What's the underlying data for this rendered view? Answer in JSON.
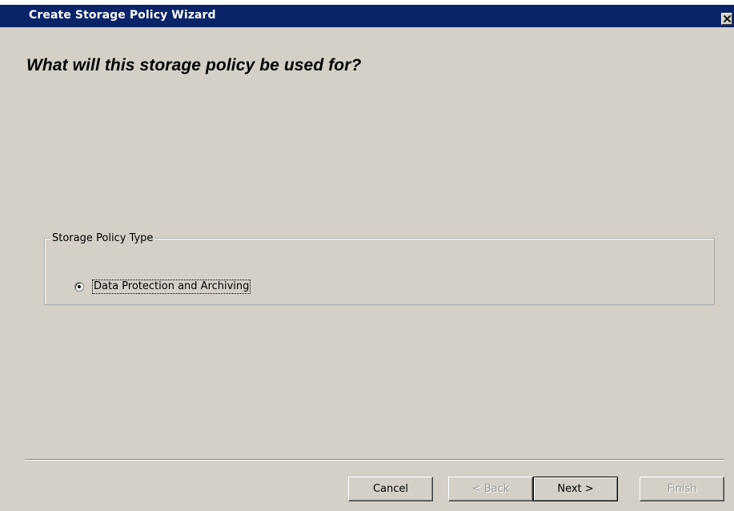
{
  "window": {
    "title": "Create Storage Policy Wizard",
    "close_icon": "close-icon"
  },
  "main": {
    "heading": "What will this storage policy be used for?"
  },
  "policy_type_group": {
    "legend": "Storage Policy Type",
    "options": [
      {
        "label": "Data Protection and Archiving",
        "selected": true
      }
    ]
  },
  "buttons": {
    "cancel": "Cancel",
    "back": "< Back",
    "next": "Next >",
    "finish": "Finish"
  },
  "colors": {
    "titlebar": "#0a246a",
    "dialog_face": "#d4d0c8",
    "disabled_text": "#9a9a9a"
  }
}
